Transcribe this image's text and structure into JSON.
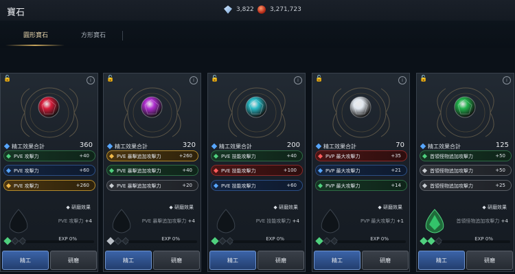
{
  "header": {
    "title": "寶石"
  },
  "currency": [
    {
      "icon": "diamond-icon",
      "value": "3,822"
    },
    {
      "icon": "red-orb-icon",
      "value": "3,271,723"
    }
  ],
  "tabs": [
    {
      "label": "圓形寶石",
      "active": true
    },
    {
      "label": "方形寶石",
      "active": false
    }
  ],
  "colors": {
    "accent_gold": "#c9a65c",
    "craft_button": "#3b64a8",
    "stat_green": "#4fd07e",
    "stat_blue": "#57a6ff",
    "stat_gold": "#f0b94a",
    "stat_red": "#ff5c5c"
  },
  "cards": [
    {
      "gem": "ruby",
      "gem_color": "#d61c3a",
      "total_label": "精工效果合計",
      "total_value": "360",
      "stats": [
        {
          "tier": "green",
          "label": "PVE 攻擊力",
          "value": "+40"
        },
        {
          "tier": "blue",
          "label": "PVE 攻擊力",
          "value": "+60"
        },
        {
          "tier": "gold",
          "label": "PVE 攻擊力",
          "value": "+260"
        }
      ],
      "research_title": "研磨效果",
      "research_line1": "PVE 攻擊力",
      "research_bonus": "+4",
      "exp": "EXP 0%",
      "exp_fill": 0,
      "slot_active": false,
      "small_gems": [
        "on",
        "off",
        "off"
      ],
      "craft_label": "精工",
      "grind_label": "研磨"
    },
    {
      "gem": "amethyst",
      "gem_color": "#b02ed0",
      "total_label": "精工效果合計",
      "total_value": "320",
      "stats": [
        {
          "tier": "gold",
          "label": "PVE 暴擊追加攻擊力",
          "value": "+260"
        },
        {
          "tier": "green",
          "label": "PVE 暴擊追加攻擊力",
          "value": "+40"
        },
        {
          "tier": "gray",
          "label": "PVE 暴擊追加攻擊力",
          "value": "+20"
        }
      ],
      "research_title": "研磨效果",
      "research_line1": "PVE 暴擊追加攻擊力",
      "research_bonus": "+4",
      "exp": "EXP 0%",
      "exp_fill": 0,
      "slot_active": false,
      "small_gems": [
        "gr",
        "off",
        "off"
      ],
      "craft_label": "精工",
      "grind_label": "研磨"
    },
    {
      "gem": "aquamarine",
      "gem_color": "#29b8c4",
      "total_label": "精工效果合計",
      "total_value": "200",
      "stats": [
        {
          "tier": "green",
          "label": "PVE 技能攻擊力",
          "value": "+40"
        },
        {
          "tier": "red",
          "label": "PVE 技能攻擊力",
          "value": "+100"
        },
        {
          "tier": "blue",
          "label": "PVE 技能攻擊力",
          "value": "+60"
        }
      ],
      "research_title": "研磨效果",
      "research_line1": "PVE 技能攻擊力",
      "research_bonus": "+4",
      "exp": "EXP 0%",
      "exp_fill": 0,
      "slot_active": false,
      "small_gems": [
        "on",
        "off",
        "off"
      ],
      "craft_label": "精工",
      "grind_label": "研磨"
    },
    {
      "gem": "diamond",
      "gem_color": "#dfe6ee",
      "total_label": "精工效果合計",
      "total_value": "70",
      "stats": [
        {
          "tier": "red",
          "label": "PVP 最大攻擊力",
          "value": "+35"
        },
        {
          "tier": "blue",
          "label": "PVP 最大攻擊力",
          "value": "+21"
        },
        {
          "tier": "green",
          "label": "PVP 最大攻擊力",
          "value": "+14"
        }
      ],
      "research_title": "研磨效果",
      "research_line1": "PVP 最大攻擊力",
      "research_bonus": "+1",
      "exp": "EXP 0%",
      "exp_fill": 0,
      "slot_active": false,
      "small_gems": [
        "on",
        "off",
        "off"
      ],
      "craft_label": "精工",
      "grind_label": "研磨"
    },
    {
      "gem": "emerald",
      "gem_color": "#22b24c",
      "total_label": "精工效果合計",
      "total_value": "125",
      "stats": [
        {
          "tier": "green",
          "label": "首領怪物追加攻擊力",
          "value": "+50"
        },
        {
          "tier": "gray",
          "label": "首領怪物追加攻擊力",
          "value": "+50"
        },
        {
          "tier": "gray",
          "label": "首領怪物追加攻擊力",
          "value": "+25"
        }
      ],
      "research_title": "研磨效果",
      "research_line1": "首領怪物追加攻擊力",
      "research_bonus": "+4",
      "exp": "EXP 0%",
      "exp_fill": 0,
      "slot_active": true,
      "small_gems": [
        "on",
        "on",
        "off"
      ],
      "craft_label": "精工",
      "grind_label": "研磨"
    }
  ]
}
